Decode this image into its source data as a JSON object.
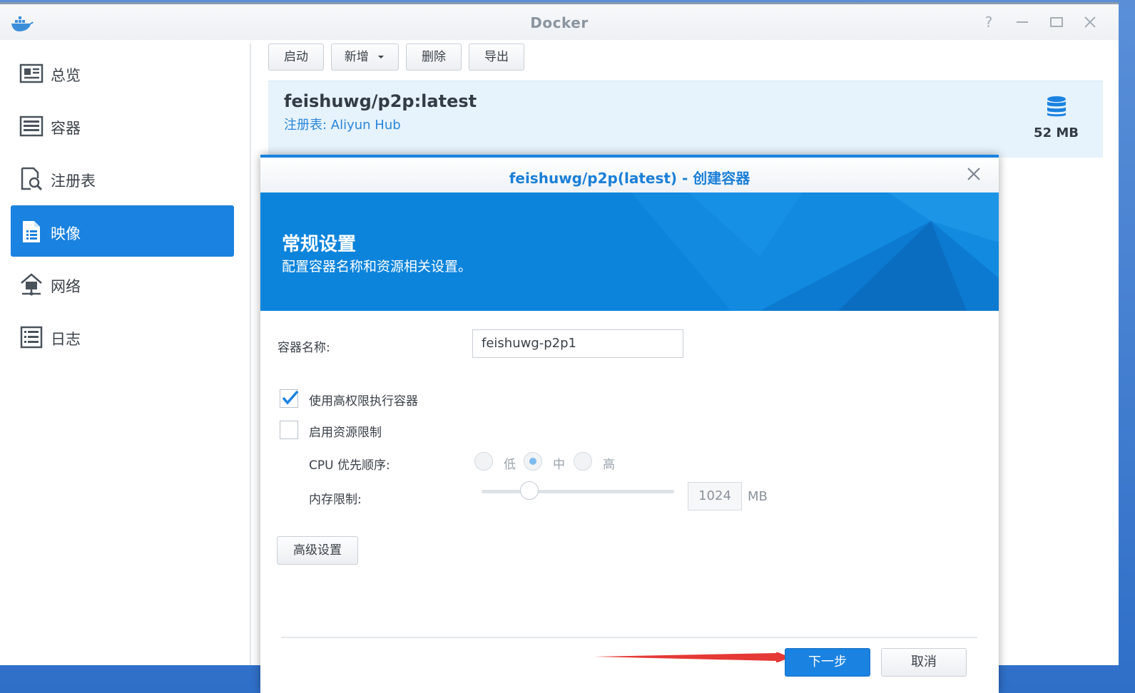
{
  "window": {
    "title": "Docker"
  },
  "colors": {
    "accent": "#1a82e0",
    "banner": "#0c84dc",
    "selected_row": "#e6f2fc",
    "annotation_arrow": "#e53935"
  },
  "sidebar": {
    "items": [
      {
        "label": "总览",
        "icon": "overview-icon",
        "active": false
      },
      {
        "label": "容器",
        "icon": "container-icon",
        "active": false
      },
      {
        "label": "注册表",
        "icon": "registry-icon",
        "active": false
      },
      {
        "label": "映像",
        "icon": "image-icon",
        "active": true
      },
      {
        "label": "网络",
        "icon": "network-icon",
        "active": false
      },
      {
        "label": "日志",
        "icon": "log-icon",
        "active": false
      }
    ]
  },
  "toolbar": {
    "launch": "启动",
    "add": "新增",
    "delete": "删除",
    "export": "导出"
  },
  "image_list": {
    "items": [
      {
        "name": "feishuwg/p2p:latest",
        "registry": "注册表: Aliyun Hub",
        "size": "52 MB"
      }
    ]
  },
  "dialog": {
    "title": "feishuwg/p2p(latest) - 创建容器",
    "banner_title": "常规设置",
    "banner_subtitle": "配置容器名称和资源相关设置。",
    "container_name_label": "容器名称:",
    "container_name_value": "feishuwg-p2p1",
    "privileged_label": "使用高权限执行容器",
    "privileged_checked": true,
    "resource_limit_label": "启用资源限制",
    "resource_limit_checked": false,
    "cpu_priority_label": "CPU 优先顺序:",
    "cpu_options": [
      "低",
      "中",
      "高"
    ],
    "cpu_selected": "中",
    "memory_label": "内存限制:",
    "memory_value": "1024",
    "memory_unit": "MB",
    "advanced_button": "高级设置",
    "next_button": "下一步",
    "cancel_button": "取消"
  }
}
